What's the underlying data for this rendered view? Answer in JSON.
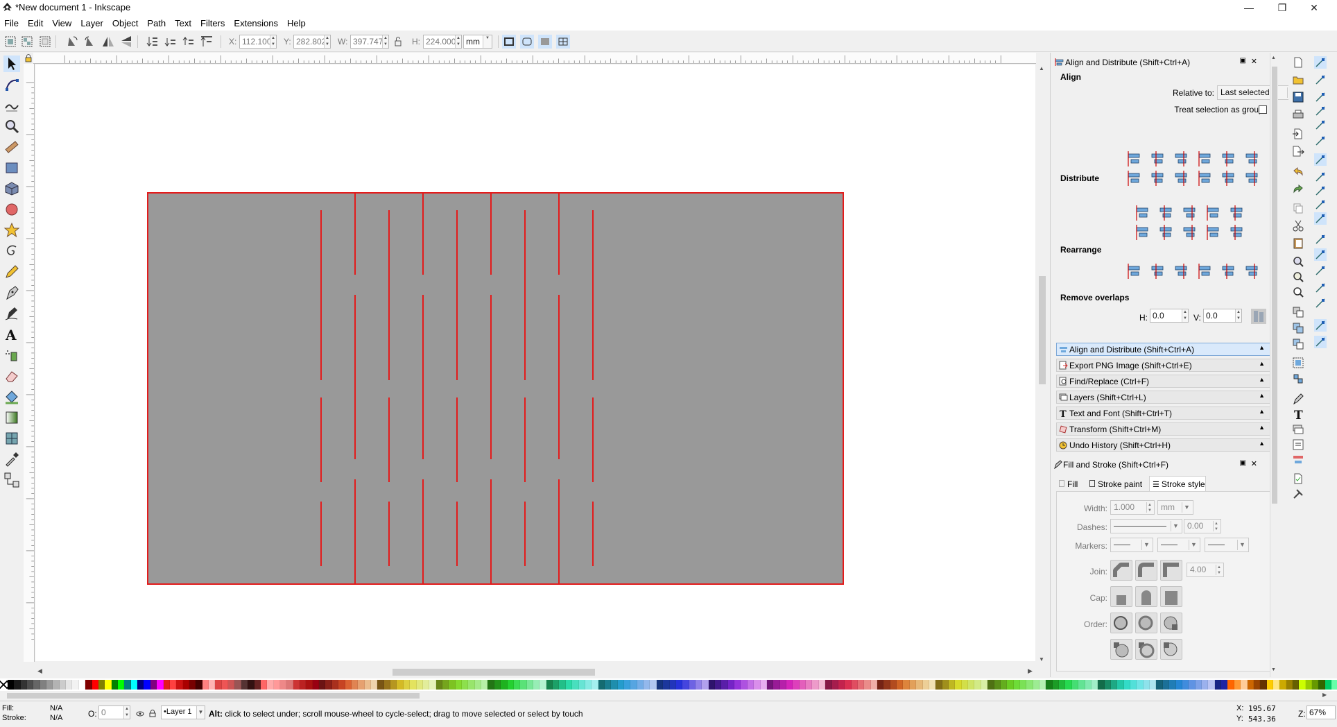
{
  "window": {
    "title": "*New document 1 - Inkscape",
    "controls": [
      "minimize",
      "maximize",
      "close"
    ]
  },
  "menu": [
    "File",
    "Edit",
    "View",
    "Layer",
    "Object",
    "Path",
    "Text",
    "Filters",
    "Extensions",
    "Help"
  ],
  "toolbar": {
    "x_label": "X:",
    "x_value": "112.100",
    "y_label": "Y:",
    "y_value": "282.802",
    "w_label": "W:",
    "w_value": "397.747",
    "h_label": "H:",
    "h_value": "224.000",
    "unit": "mm"
  },
  "dock": {
    "align": {
      "title": "Align and Distribute (Shift+Ctrl+A)",
      "align_heading": "Align",
      "relative_to_label": "Relative to:",
      "relative_to_value": "Last selected",
      "treat_group_label": "Treat selection as group:",
      "distribute_heading": "Distribute",
      "rearrange_heading": "Rearrange",
      "remove_overlaps_heading": "Remove overlaps",
      "h_label": "H:",
      "h_value": "0.0",
      "v_label": "V:",
      "v_value": "0.0"
    },
    "collapsed_panels": [
      "Align and Distribute (Shift+Ctrl+A)",
      "Export PNG Image (Shift+Ctrl+E)",
      "Find/Replace (Ctrl+F)",
      "Layers (Shift+Ctrl+L)",
      "Text and Font (Shift+Ctrl+T)",
      "Transform (Shift+Ctrl+M)",
      "Undo History (Shift+Ctrl+H)"
    ],
    "fill_stroke": {
      "title": "Fill and Stroke (Shift+Ctrl+F)",
      "tab_fill": "Fill",
      "tab_stroke_paint": "Stroke paint",
      "tab_stroke_style": "Stroke style",
      "width_label": "Width:",
      "width_value": "1.000",
      "width_unit": "mm",
      "dashes_label": "Dashes:",
      "dashes_value": "0.00",
      "markers_label": "Markers:",
      "join_label": "Join:",
      "join_value": "4.00",
      "cap_label": "Cap:",
      "order_label": "Order:"
    }
  },
  "status": {
    "fill_label": "Fill:",
    "fill_value": "N/A",
    "stroke_label": "Stroke:",
    "stroke_value": "N/A",
    "opacity_label": "O:",
    "opacity_value": "0",
    "layer": "•Layer 1",
    "message_bold": "Alt:",
    "message": " click to select under; scroll mouse-wheel to cycle-select; drag to move selected or select by touch",
    "cursor_x_label": "X:",
    "cursor_x": "195.67",
    "cursor_y_label": "Y:",
    "cursor_y": "543.36",
    "zoom_label": "Z:",
    "zoom_value": "67%"
  },
  "colors": {
    "page_fill": "#999999",
    "stroke_red": "#e31b1b",
    "accent_blue": "#cfe4fb"
  }
}
